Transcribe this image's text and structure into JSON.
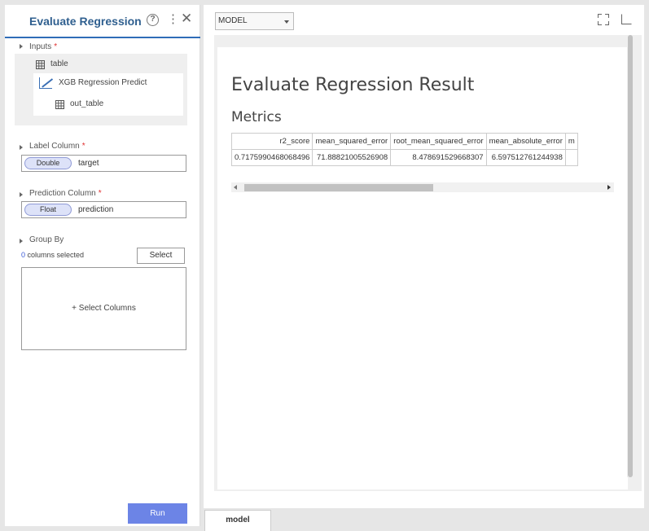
{
  "panel": {
    "title": "Evaluate Regression",
    "inputs_label": "Inputs",
    "required_mark": "*",
    "input_nodes": {
      "table": "table",
      "predict": "XGB Regression Predict",
      "out_table": "out_table"
    },
    "label_column": {
      "label": "Label Column",
      "type": "Double",
      "value": "target"
    },
    "prediction_column": {
      "label": "Prediction Column",
      "type": "Float",
      "value": "prediction"
    },
    "group_by": {
      "label": "Group By",
      "count": "0",
      "count_suffix": "columns selected",
      "select_button": "Select",
      "select_columns_label": "+ Select Columns"
    },
    "run_button": "Run"
  },
  "viewer": {
    "dropdown_value": "MODEL",
    "result_title": "Evaluate Regression Result",
    "metrics_title": "Metrics",
    "metrics_table": {
      "headers": [
        "r2_score",
        "mean_squared_error",
        "root_mean_squared_error",
        "mean_absolute_error",
        "m"
      ],
      "row": [
        "0.7175990468068496",
        "71.88821005526908",
        "8.478691529668307",
        "6.597512761244938",
        ""
      ]
    },
    "bottom_tab": "model"
  },
  "colors": {
    "title_blue": "#2f5f8f",
    "run_button": "#6c84e6",
    "pill_bg": "#dde2f8",
    "required": "#e03030"
  },
  "icons": [
    "help-icon",
    "more-vertical-icon",
    "close-icon",
    "table-grid-icon",
    "line-chart-icon",
    "expand-icon",
    "open-external-icon",
    "dropdown-caret-icon"
  ]
}
